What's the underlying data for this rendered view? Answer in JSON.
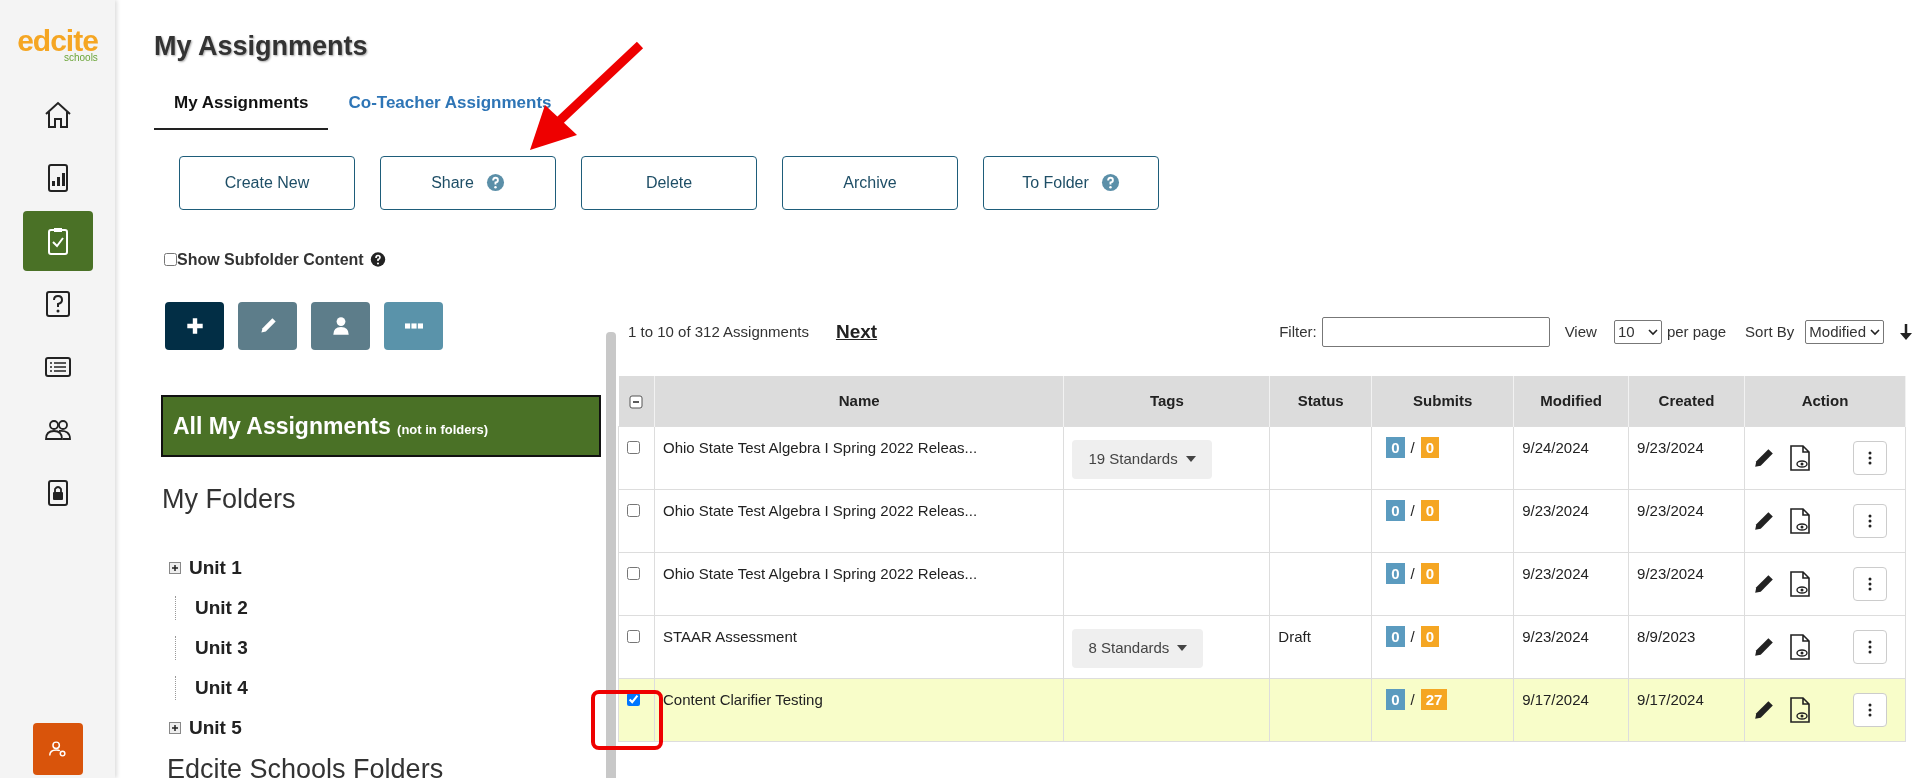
{
  "sidebar": {
    "items": [
      {
        "kind": "home",
        "selected": false
      },
      {
        "kind": "chart",
        "selected": false
      },
      {
        "kind": "clipboard",
        "selected": true
      },
      {
        "kind": "question",
        "selected": false
      },
      {
        "kind": "list",
        "selected": false
      },
      {
        "kind": "people",
        "selected": false
      },
      {
        "kind": "lock",
        "selected": false
      }
    ],
    "logo": {
      "word": "edcite",
      "sub": "schools"
    }
  },
  "page_title": "My Assignments",
  "tabs": [
    {
      "label": "My Assignments",
      "selected": true
    },
    {
      "label": "Co-Teacher Assignments",
      "selected": false
    }
  ],
  "toolbar": [
    {
      "label": "Create New",
      "help": false
    },
    {
      "label": "Share",
      "help": true
    },
    {
      "label": "Delete",
      "help": false
    },
    {
      "label": "Archive",
      "help": false
    },
    {
      "label": "To Folder",
      "help": true
    }
  ],
  "subfolder": {
    "label": "Show Subfolder Content",
    "checked": false
  },
  "folder_actions": [
    {
      "kind": "add"
    },
    {
      "kind": "edit"
    },
    {
      "kind": "user"
    },
    {
      "kind": "more"
    }
  ],
  "all_assignments": {
    "label": "All My Assignments",
    "note": "(not in folders)"
  },
  "my_folders": {
    "heading": "My Folders",
    "items": [
      {
        "label": "Unit 1",
        "expandable": true
      },
      {
        "label": "Unit 2",
        "expandable": false
      },
      {
        "label": "Unit 3",
        "expandable": false
      },
      {
        "label": "Unit 4",
        "expandable": false
      },
      {
        "label": "Unit 5",
        "expandable": true
      }
    ]
  },
  "school_folders": {
    "heading": "Edcite Schools Folders"
  },
  "pagination": {
    "summary": "1 to 10 of 312 Assignments",
    "next": "Next"
  },
  "filter": {
    "label": "Filter:"
  },
  "view": {
    "label": "View",
    "value": "10",
    "suffix": "per page"
  },
  "sort": {
    "label": "Sort By",
    "value": "Modified"
  },
  "table": {
    "columns": [
      "Name",
      "Tags",
      "Status",
      "Submits",
      "Modified",
      "Created",
      "Action"
    ],
    "rows": [
      {
        "checked": false,
        "name": "Ohio State Test Algebra I Spring 2022 Releas...",
        "tags": "19 Standards",
        "submits": [
          "0",
          "/",
          "0"
        ],
        "modified": "9/24/2024",
        "created": "9/23/2024"
      },
      {
        "checked": false,
        "name": "Ohio State Test Algebra I Spring 2022 Releas...",
        "submits": [
          "0",
          "/",
          "0"
        ],
        "modified": "9/23/2024",
        "created": "9/23/2024"
      },
      {
        "checked": false,
        "name": "Ohio State Test Algebra I Spring 2022 Releas...",
        "submits": [
          "0",
          "/",
          "0"
        ],
        "modified": "9/23/2024",
        "created": "9/23/2024"
      },
      {
        "checked": false,
        "name": "STAAR Assessment",
        "tags": "8 Standards",
        "status": "Draft",
        "submits": [
          "0",
          "/",
          "0"
        ],
        "modified": "9/23/2024",
        "created": "8/9/2023"
      },
      {
        "checked": true,
        "name": "Content Clarifier Testing",
        "submits": [
          "0",
          "/",
          "27"
        ],
        "modified": "9/17/2024",
        "created": "9/17/2024"
      }
    ]
  }
}
